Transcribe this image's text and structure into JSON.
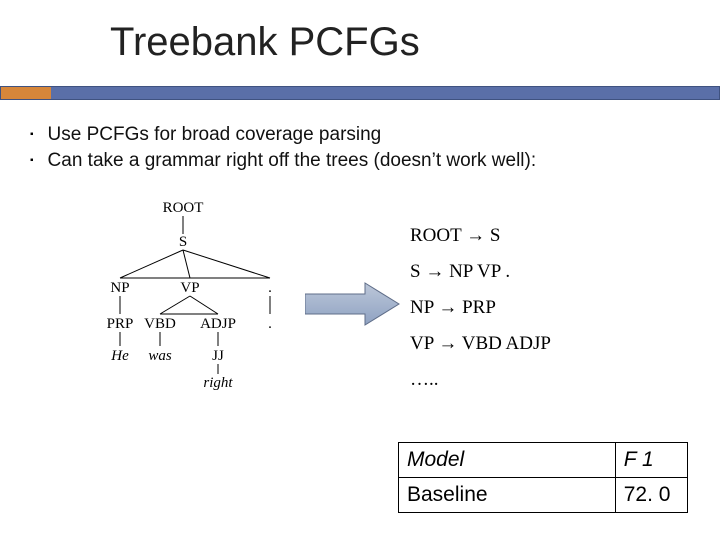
{
  "title": "Treebank PCFGs",
  "bullets": [
    "Use PCFGs for broad coverage parsing",
    "Can take a grammar right off the trees (doesn’t work well):"
  ],
  "tree": {
    "nodes": {
      "ROOT": "ROOT",
      "S": "S",
      "NP": "NP",
      "VP": "VP",
      "DOT": ".",
      "PRP": "PRP",
      "VBD": "VBD",
      "ADJP": "ADJP",
      "DOT2": ".",
      "JJ": "JJ",
      "He": "He",
      "was": "was",
      "right": "right"
    }
  },
  "rules": [
    "ROOT → S",
    "S → NP VP .",
    "NP → PRP",
    "VP → VBD ADJP",
    "….."
  ],
  "table": {
    "header": {
      "label": "Model",
      "score_label": "F 1"
    },
    "rows": [
      {
        "label": "Baseline",
        "score": "72. 0"
      }
    ]
  }
}
